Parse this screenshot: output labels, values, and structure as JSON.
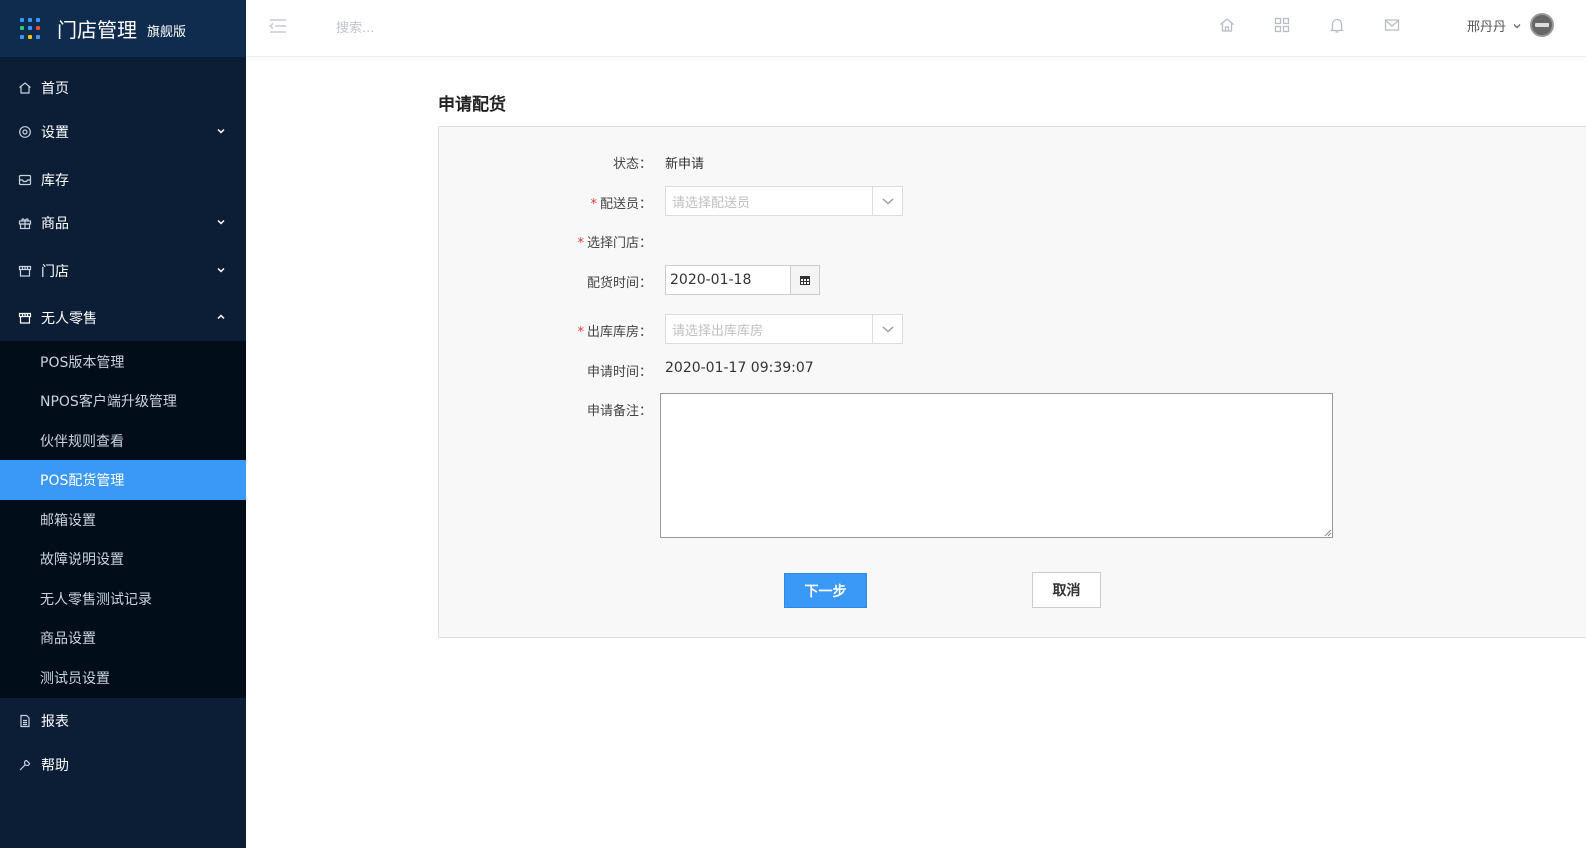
{
  "brand": {
    "title": "门店管理",
    "subtitle": "旗舰版"
  },
  "header": {
    "search_placeholder": "搜索...",
    "user_name": "邢丹丹"
  },
  "sidebar": {
    "items": [
      {
        "label": "首页",
        "icon": "home-icon"
      },
      {
        "label": "设置",
        "icon": "gear-icon"
      },
      {
        "label": "库存",
        "icon": "inbox-icon"
      },
      {
        "label": "商品",
        "icon": "gift-icon"
      },
      {
        "label": "门店",
        "icon": "store-icon"
      },
      {
        "label": "无人零售",
        "icon": "store-icon"
      },
      {
        "label": "报表",
        "icon": "document-icon"
      },
      {
        "label": "帮助",
        "icon": "wrench-icon"
      }
    ],
    "submenu": [
      {
        "label": "POS版本管理"
      },
      {
        "label": "NPOS客户端升级管理"
      },
      {
        "label": "伙伴规则查看"
      },
      {
        "label": "POS配货管理"
      },
      {
        "label": "邮箱设置"
      },
      {
        "label": "故障说明设置"
      },
      {
        "label": "无人零售测试记录"
      },
      {
        "label": "商品设置"
      },
      {
        "label": "测试员设置"
      }
    ]
  },
  "page": {
    "title": "申请配货"
  },
  "form": {
    "status_label": "状态：",
    "status_value": "新申请",
    "courier_label": "配送员：",
    "courier_placeholder": "请选择配送员",
    "store_label": "选择门店：",
    "date_label": "配货时间：",
    "date_value": "2020-01-18",
    "warehouse_label": "出库库房：",
    "warehouse_placeholder": "请选择出库库房",
    "apply_time_label": "申请时间：",
    "apply_time_value": "2020-01-17 09:39:07",
    "remark_label": "申请备注：",
    "required_mark": "*",
    "next_label": "下一步",
    "cancel_label": "取消"
  },
  "colors": {
    "sidebar_bg": "#0b1e36",
    "brand_bg": "#0f2b4d",
    "accent": "#3a98f7",
    "required": "#e4393c"
  }
}
